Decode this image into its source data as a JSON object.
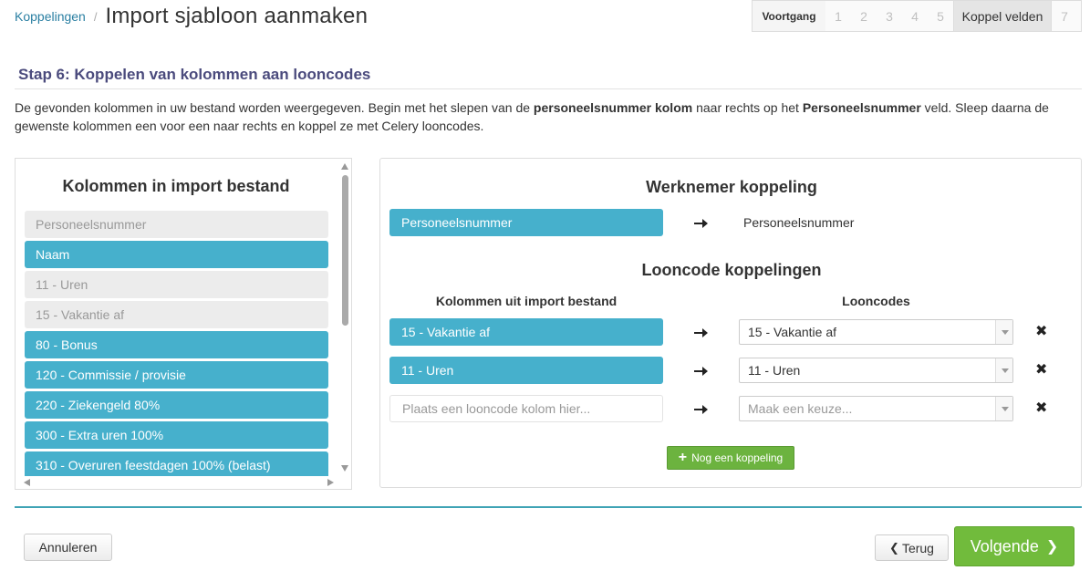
{
  "header": {
    "breadcrumb_link": "Koppelingen",
    "breadcrumb_separator": "/",
    "title": "Import sjabloon aanmaken"
  },
  "progress": {
    "label": "Voortgang",
    "steps": [
      "1",
      "2",
      "3",
      "4",
      "5"
    ],
    "active_step": "Koppel velden",
    "last_step": "7"
  },
  "step": {
    "heading": "Stap 6: Koppelen van kolommen aan looncodes",
    "intro_part1": "De gevonden kolommen in uw bestand worden weergegeven. Begin met het slepen van de ",
    "intro_bold1": "personeelsnummer kolom",
    "intro_part2": " naar rechts op het ",
    "intro_bold2": "Personeelsnummer",
    "intro_part3": " veld. Sleep daarna de gewenste kolommen een voor een naar rechts en koppel ze met Celery looncodes."
  },
  "left_panel": {
    "title": "Kolommen in import bestand",
    "columns": [
      {
        "label": "Personeelsnummer",
        "state": "disabled"
      },
      {
        "label": "Naam",
        "state": "active"
      },
      {
        "label": "11 - Uren",
        "state": "disabled"
      },
      {
        "label": "15 - Vakantie af",
        "state": "disabled"
      },
      {
        "label": "80 - Bonus",
        "state": "active"
      },
      {
        "label": "120 - Commissie / provisie",
        "state": "active"
      },
      {
        "label": "220 - Ziekengeld 80%",
        "state": "active"
      },
      {
        "label": "300 - Extra uren 100%",
        "state": "active"
      },
      {
        "label": "310 - Overuren feestdagen 100% (belast)",
        "state": "active"
      }
    ]
  },
  "right_panel": {
    "employee_title": "Werknemer koppeling",
    "employee_source": "Personeelsnummer",
    "employee_target": "Personeelsnummer",
    "looncode_title": "Looncode koppelingen",
    "col_head_source": "Kolommen uit import bestand",
    "col_head_target": "Looncodes",
    "mappings": [
      {
        "source": "15 - Vakantie af",
        "target": "15 - Vakantie af"
      },
      {
        "source": "11 - Uren",
        "target": "11 - Uren"
      }
    ],
    "placeholder_source": "Plaats een looncode kolom hier...",
    "placeholder_target": "Maak een keuze...",
    "add_button": "Nog een koppeling"
  },
  "footer": {
    "cancel": "Annuleren",
    "back": "Terug",
    "next": "Volgende"
  },
  "icons": {
    "arrow": "arrow-right-icon",
    "remove": "close-icon",
    "add": "plus-icon"
  },
  "colors": {
    "accent_blue": "#46b0cc",
    "primary_green": "#71bb3c",
    "heading_purple": "#4b4b7d",
    "rule_teal": "#3fa3b5"
  }
}
